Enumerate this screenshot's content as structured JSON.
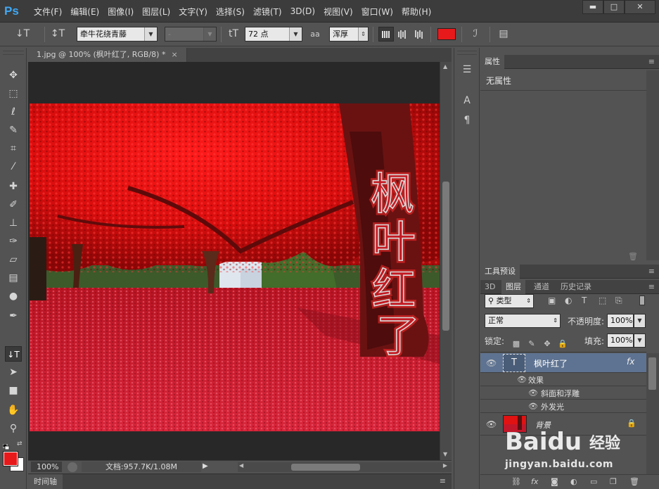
{
  "app": {
    "logo": "Ps",
    "menu": [
      "文件(F)",
      "编辑(E)",
      "图像(I)",
      "图层(L)",
      "文字(Y)",
      "选择(S)",
      "滤镜(T)",
      "3D(D)",
      "视图(V)",
      "窗口(W)",
      "帮助(H)"
    ],
    "window_buttons": {
      "minimize": "▬",
      "maximize": "□",
      "close": "✕"
    }
  },
  "options_bar": {
    "tool_icon": "↓T",
    "orientation_icon": "↕T",
    "font_family": "牵牛花绕青藤",
    "font_style": "-",
    "size_icon": "tT",
    "font_size": "72 点",
    "aa_icon": "aa",
    "anti_alias": "浑厚",
    "text_color": "#e8191b"
  },
  "tools": [
    {
      "name": "move-tool-icon",
      "glyph": "✥"
    },
    {
      "name": "marquee-tool-icon",
      "glyph": "⬚"
    },
    {
      "name": "lasso-tool-icon",
      "glyph": "ℓ"
    },
    {
      "name": "quick-select-tool-icon",
      "glyph": "✎"
    },
    {
      "name": "crop-tool-icon",
      "glyph": "⌗"
    },
    {
      "name": "eyedropper-tool-icon",
      "glyph": "⁄"
    },
    {
      "name": "healing-brush-tool-icon",
      "glyph": "✚"
    },
    {
      "name": "brush-tool-icon",
      "glyph": "✐"
    },
    {
      "name": "clone-stamp-tool-icon",
      "glyph": "⊥"
    },
    {
      "name": "history-brush-tool-icon",
      "glyph": "✑"
    },
    {
      "name": "eraser-tool-icon",
      "glyph": "▱"
    },
    {
      "name": "gradient-tool-icon",
      "glyph": "▤"
    },
    {
      "name": "dodge-tool-icon",
      "glyph": "●"
    },
    {
      "name": "pen-tool-icon",
      "glyph": "✒"
    },
    {
      "name": "type-tool-icon",
      "glyph": "↓T"
    },
    {
      "name": "path-select-tool-icon",
      "glyph": "➤"
    },
    {
      "name": "rectangle-tool-icon",
      "glyph": "■"
    },
    {
      "name": "hand-tool-icon",
      "glyph": "✋"
    },
    {
      "name": "zoom-tool-icon",
      "glyph": "⚲"
    }
  ],
  "colors": {
    "foreground": "#e8191b",
    "background": "#ffffff"
  },
  "document": {
    "tab_title": "1.jpg @ 100% (枫叶红了, RGB/8) *",
    "close_glyph": "×",
    "zoom": "100%",
    "info": "文档:957.7K/1.08M",
    "overlay_text": [
      "枫",
      "叶",
      "红",
      "了"
    ]
  },
  "timeline": {
    "label": "时间轴"
  },
  "properties_panel": {
    "tab": "属性",
    "body_text": "无属性"
  },
  "tool_presets_panel": {
    "tab": "工具预设"
  },
  "layers_panel": {
    "tabs": [
      "3D",
      "图层",
      "通道",
      "历史记录"
    ],
    "filter_kind": "类型",
    "blend_mode": "正常",
    "opacity_label": "不透明度:",
    "opacity": "100%",
    "lock_label": "锁定:",
    "fill_label": "填充:",
    "fill": "100%",
    "layers": [
      {
        "name": "枫叶红了",
        "thumb": "T",
        "fx": "fx",
        "effects_label": "效果",
        "effects": [
          "斜面和浮雕",
          "外发光"
        ]
      },
      {
        "name": "背景",
        "thumb": "img"
      }
    ],
    "footer_icons": [
      "link-icon",
      "fx-icon",
      "mask-icon",
      "adjustment-icon",
      "group-icon",
      "new-layer-icon",
      "trash-icon"
    ]
  },
  "watermark": {
    "brand": "Baidu",
    "brand_cn": "经验",
    "url": "jingyan.baidu.com"
  }
}
